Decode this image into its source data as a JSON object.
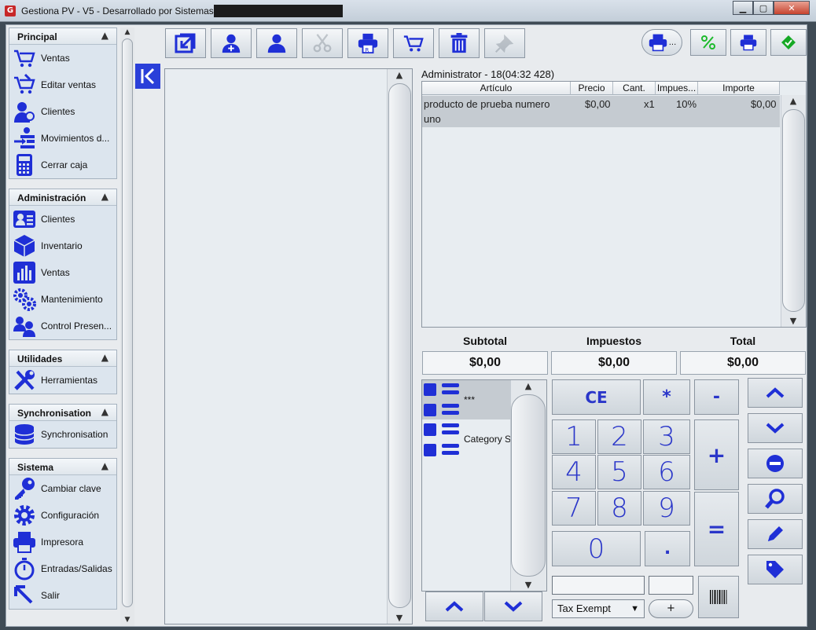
{
  "titlebar": {
    "title": "Gestiona PV - V5 - Desarrollado por Sistemas",
    "app_icon_letter": "G",
    "minimize": "▁",
    "maximize": "▢",
    "close": "✕"
  },
  "sidebar": {
    "sections": [
      {
        "title": "Principal",
        "items": [
          {
            "label": "Ventas",
            "icon": "cart-icon"
          },
          {
            "label": "Editar ventas",
            "icon": "edit-cart-icon"
          },
          {
            "label": "Clientes",
            "icon": "customer-icon"
          },
          {
            "label": "Movimientos d...",
            "icon": "movements-icon"
          },
          {
            "label": "Cerrar caja",
            "icon": "calculator-icon"
          }
        ]
      },
      {
        "title": "Administración",
        "items": [
          {
            "label": "Clientes",
            "icon": "contact-card-icon"
          },
          {
            "label": "Inventario",
            "icon": "box-icon"
          },
          {
            "label": "Ventas",
            "icon": "bar-chart-icon"
          },
          {
            "label": "Mantenimiento",
            "icon": "gears-icon"
          },
          {
            "label": "Control Presen...",
            "icon": "people-icon"
          }
        ]
      },
      {
        "title": "Utilidades",
        "items": [
          {
            "label": "Herramientas",
            "icon": "tools-icon"
          }
        ]
      },
      {
        "title": "Synchronisation",
        "items": [
          {
            "label": "Synchronisation",
            "icon": "database-icon"
          }
        ]
      },
      {
        "title": "Sistema",
        "items": [
          {
            "label": "Cambiar clave",
            "icon": "key-icon"
          },
          {
            "label": "Configuración",
            "icon": "gear-icon"
          },
          {
            "label": "Impresora",
            "icon": "printer-icon"
          },
          {
            "label": "Entradas/Salidas",
            "icon": "stopwatch-icon"
          },
          {
            "label": "Salir",
            "icon": "exit-icon"
          }
        ]
      }
    ]
  },
  "ticket": {
    "header": "Administrator -   18(04:32 428)",
    "columns": [
      "Artículo",
      "Precio",
      "Cant.",
      "Impues...",
      "Importe"
    ],
    "rows": [
      {
        "articulo_line1": "producto de prueba numero",
        "articulo_line2": "uno",
        "precio": "$0,00",
        "cantidad": "x1",
        "impuesto": "10%",
        "importe": "$0,00"
      }
    ]
  },
  "totals": {
    "subtotal_label": "Subtotal",
    "subtotal": "$0,00",
    "impuestos_label": "Impuestos",
    "impuestos": "$0,00",
    "total_label": "Total",
    "total": "$0,00"
  },
  "categories": [
    "***",
    "Category S"
  ],
  "keypad": {
    "ce": "CE",
    "multiply": "*",
    "minus": "-",
    "plus": "+",
    "equals": "=",
    "dot": ".",
    "digits": [
      "1",
      "2",
      "3",
      "4",
      "5",
      "6",
      "7",
      "8",
      "9",
      "0"
    ]
  },
  "tax_select": {
    "value": "Tax Exempt"
  },
  "plus_button": "+",
  "colors": {
    "accent": "#2a36c9",
    "brand_blue": "#1f2fd6",
    "selection": "#c5cbd1"
  }
}
